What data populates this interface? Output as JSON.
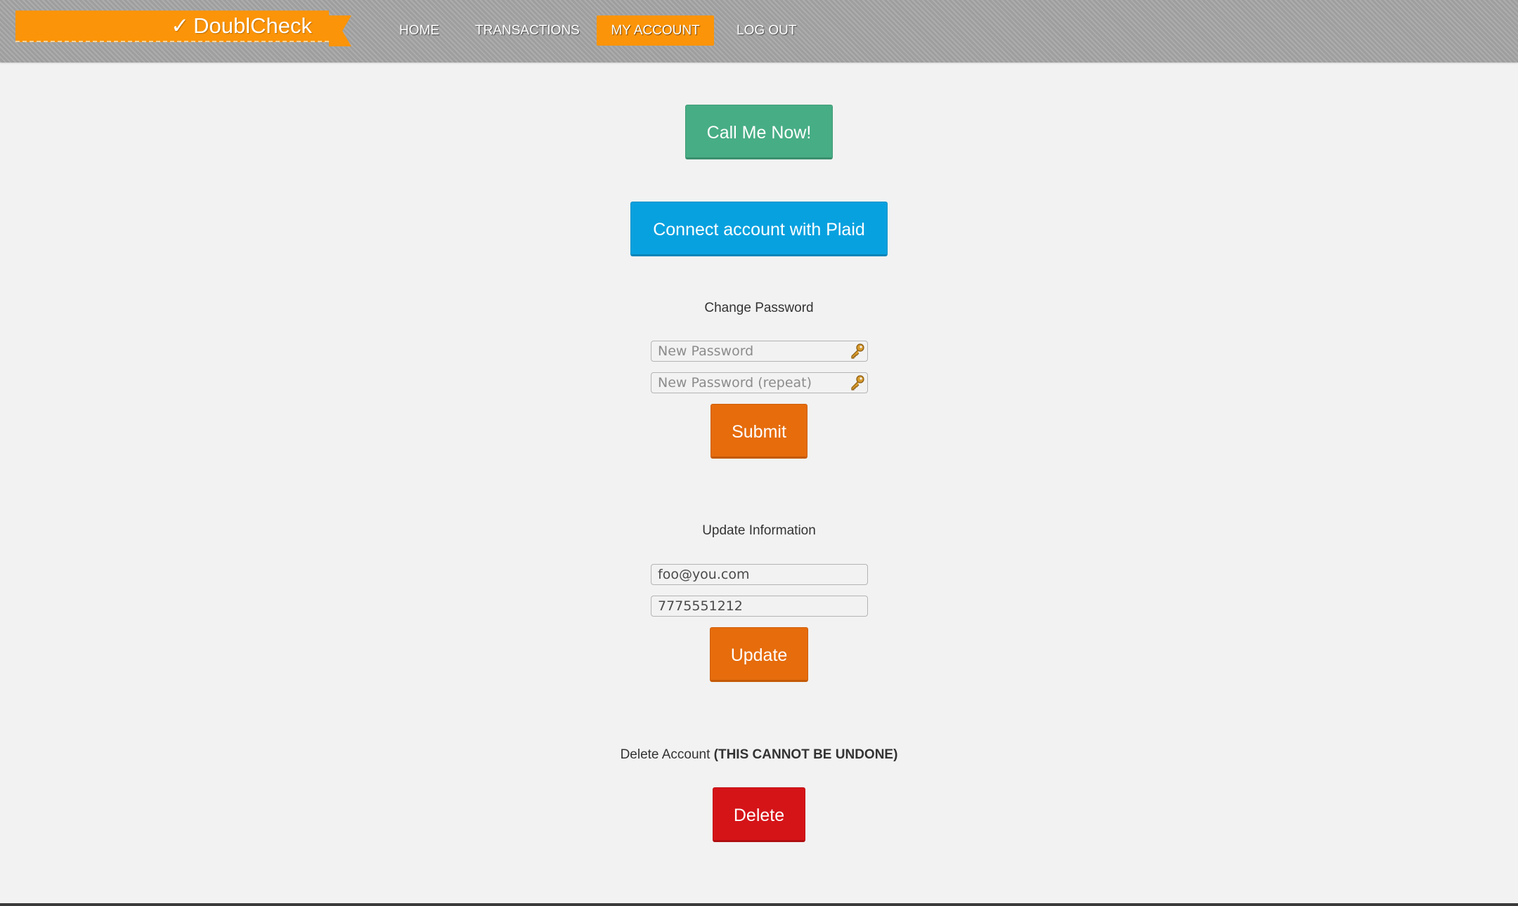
{
  "header": {
    "logo": {
      "check_glyph": "✓",
      "brand_name": "DoublCheck",
      "color": "#fb9408"
    },
    "nav": [
      {
        "label": "HOME",
        "active": false
      },
      {
        "label": "TRANSACTIONS",
        "active": false
      },
      {
        "label": "MY ACCOUNT",
        "active": true
      },
      {
        "label": "LOG OUT",
        "active": false
      }
    ]
  },
  "main": {
    "call_button_label": "Call Me Now!",
    "plaid_button_label": "Connect account with Plaid",
    "change_password": {
      "title": "Change Password",
      "new_password_placeholder": "New Password",
      "repeat_password_placeholder": "New Password (repeat)",
      "password_icon": "key-icon",
      "submit_label": "Submit"
    },
    "update_information": {
      "title": "Update Information",
      "email_value": "foo@you.com",
      "phone_value": "7775551212",
      "update_label": "Update"
    },
    "delete_account": {
      "title": "Delete Account",
      "warning": "(THIS CANNOT BE UNDONE)",
      "delete_label": "Delete"
    }
  },
  "colors": {
    "accent_orange": "#fb9408",
    "action_orange": "#e66c0c",
    "call_green": "#47ad85",
    "plaid_blue": "#08a1df",
    "danger_red": "#d51418",
    "background": "#f2f2f2"
  }
}
